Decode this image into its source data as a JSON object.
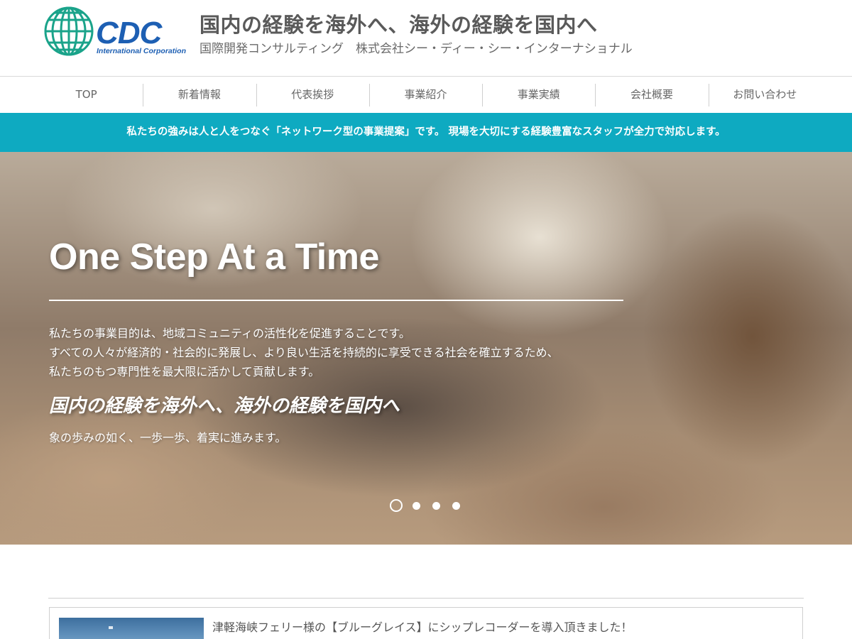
{
  "header": {
    "logo": {
      "name": "CDC",
      "tagline": "International Corporation",
      "colors": {
        "globe": "#1aa38a",
        "text": "#1d5fb3"
      }
    },
    "title": "国内の経験を海外へ、海外の経験を国内へ",
    "subtitle": "国際開発コンサルティング　株式会社シー・ディー・シー・インターナショナル"
  },
  "nav": {
    "items": [
      {
        "label": "TOP"
      },
      {
        "label": "新着情報"
      },
      {
        "label": "代表挨拶"
      },
      {
        "label": "事業紹介"
      },
      {
        "label": "事業実績"
      },
      {
        "label": "会社概要"
      },
      {
        "label": "お問い合わせ"
      }
    ]
  },
  "banner": {
    "text": "私たちの強みは人と人をつなぐ「ネットワーク型の事業提案」です。 現場を大切にする経験豊富なスタッフが全力で対応します。",
    "color": "#0eaac1"
  },
  "hero": {
    "title": "One Step At a Time",
    "lines": [
      "私たちの事業目的は、地域コミュニティの活性化を促進することです。",
      "すべての人々が経済的・社会的に発展し、より良い生活を持続的に享受できる社会を確立するため、",
      "私たちのもつ専門性を最大限に活かして貢献します。"
    ],
    "emphasis": "国内の経験を海外へ、海外の経験を国内へ",
    "tail": "象の歩みの如く、一歩一歩、着実に進みます。",
    "slides": {
      "count": 4,
      "active": 1
    }
  },
  "news": {
    "items": [
      {
        "title": "津軽海峡フェリー様の【ブルーグレイス】にシップレコーダーを導入頂きました！"
      }
    ]
  }
}
